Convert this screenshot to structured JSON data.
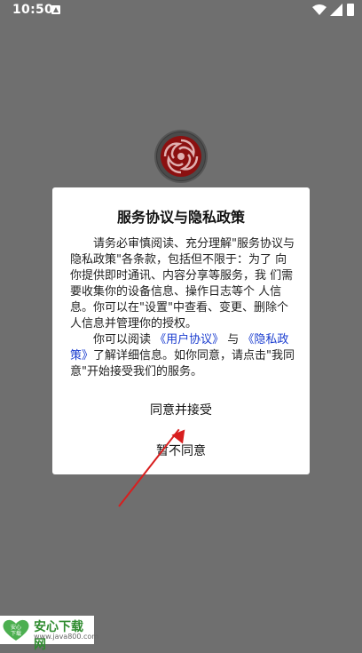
{
  "status_bar": {
    "time": "10:50"
  },
  "dialog": {
    "title": "服务协议与隐私政策",
    "paragraph1": "请务必审慎阅读、充分理解\"服务协议与 隐私政策\"各条款，包括但不限于：为了 向你提供即时通讯、内容分享等服务，我 们需要收集你的设备信息、操作日志等个 人信息。你可以在\"设置\"中查看、变更、删除个人信息并管理你的授权。",
    "p2_before": "你可以阅读 ",
    "user_agreement_link": "《用户协议》",
    "p2_middle": " 与 ",
    "privacy_policy_link": "《隐私政策》",
    "p2_after": "了解详细信息。如你同意，请点击\"我同意\"开始接受我们的服务。",
    "accept_button": "同意并接受",
    "decline_button": "暂不同意"
  },
  "watermark": {
    "title": "安心下载网",
    "url": "www.java800.com",
    "icon_text_top": "安心",
    "icon_text_bottom": "下载"
  },
  "colors": {
    "overlay": "#6f6f6f",
    "link": "#1a3ccf",
    "accent": "#d81e1e"
  }
}
